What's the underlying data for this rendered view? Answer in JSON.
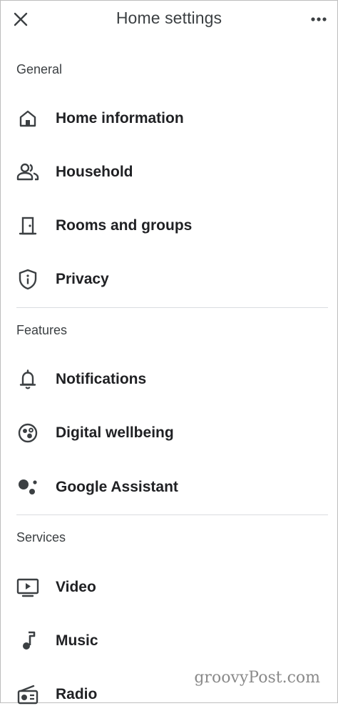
{
  "header": {
    "title": "Home settings",
    "close_icon": "close-icon",
    "more_icon": "more-horizontal-icon"
  },
  "sections": [
    {
      "header": "General",
      "items": [
        {
          "label": "Home information",
          "icon": "home-icon"
        },
        {
          "label": "Household",
          "icon": "people-icon"
        },
        {
          "label": "Rooms and groups",
          "icon": "door-icon"
        },
        {
          "label": "Privacy",
          "icon": "shield-info-icon"
        }
      ]
    },
    {
      "header": "Features",
      "items": [
        {
          "label": "Notifications",
          "icon": "bell-icon"
        },
        {
          "label": "Digital wellbeing",
          "icon": "wellbeing-icon"
        },
        {
          "label": "Google Assistant",
          "icon": "assistant-dots-icon"
        }
      ]
    },
    {
      "header": "Services",
      "items": [
        {
          "label": "Video",
          "icon": "tv-play-icon"
        },
        {
          "label": "Music",
          "icon": "music-note-icon"
        },
        {
          "label": "Radio",
          "icon": "radio-icon"
        }
      ]
    }
  ],
  "watermark": "groovyPost.com",
  "colors": {
    "text": "#202124",
    "icon": "#3c4043",
    "divider": "#dadce0"
  }
}
